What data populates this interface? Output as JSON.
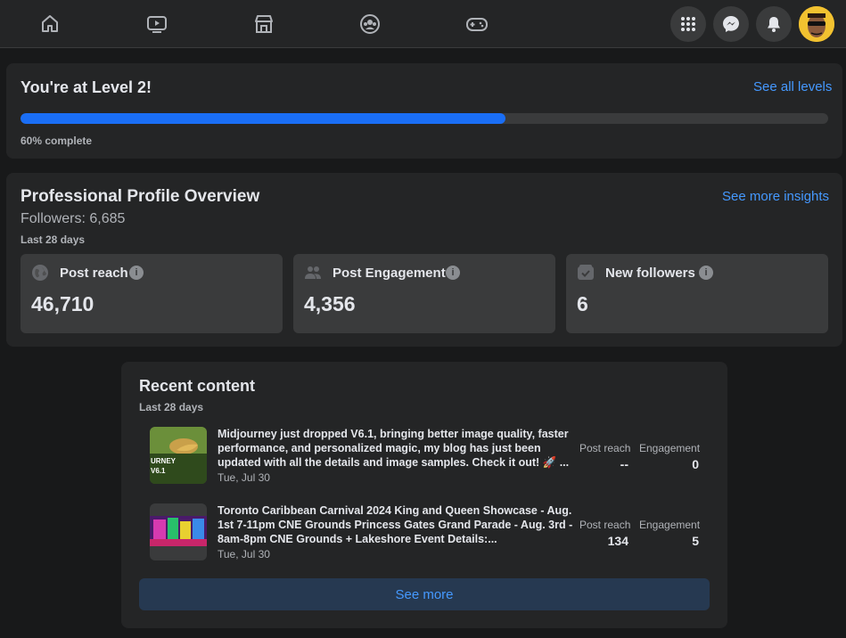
{
  "nav": {
    "icons": [
      "home-icon",
      "watch-icon",
      "marketplace-icon",
      "groups-icon",
      "gaming-icon"
    ],
    "right_icons": [
      "menu-grid-icon",
      "messenger-icon",
      "notifications-icon",
      "avatar"
    ]
  },
  "level": {
    "title": "You're at Level 2!",
    "link": "See all levels",
    "progress_percent": 60,
    "progress_text": "60% complete"
  },
  "overview": {
    "title": "Professional Profile Overview",
    "followers": "Followers: 6,685",
    "period": "Last 28 days",
    "link": "See more insights",
    "stats": [
      {
        "label": "Post reach",
        "value": "46,710",
        "icon": "globe-icon"
      },
      {
        "label": "Post Engagement",
        "value": "4,356",
        "icon": "people-icon"
      },
      {
        "label": "New followers",
        "value": "6",
        "icon": "follower-check-icon"
      }
    ]
  },
  "recent": {
    "title": "Recent content",
    "period": "Last 28 days",
    "posts": [
      {
        "text": "Midjourney just dropped V6.1, bringing better image quality, faster performance, and personalized magic, my blog has just been updated with all the details and image samples. Check it out! 🚀 ...",
        "date": "Tue, Jul 30",
        "reach_label": "Post reach",
        "reach": "--",
        "engagement_label": "Engagement",
        "engagement": "0",
        "thumb_text": "URNEY V6.1"
      },
      {
        "text": "Toronto Caribbean Carnival 2024 King and Queen Showcase - Aug. 1st 7-11pm CNE Grounds Princess Gates Grand Parade - Aug. 3rd - 8am-8pm CNE Grounds + Lakeshore Event Details:...",
        "date": "Tue, Jul 30",
        "reach_label": "Post reach",
        "reach": "134",
        "engagement_label": "Engagement",
        "engagement": "5"
      }
    ],
    "see_more": "See more"
  },
  "colors": {
    "background": "#18191a",
    "card": "#242526",
    "accent": "#1a6ef5",
    "link": "#4599ff"
  }
}
